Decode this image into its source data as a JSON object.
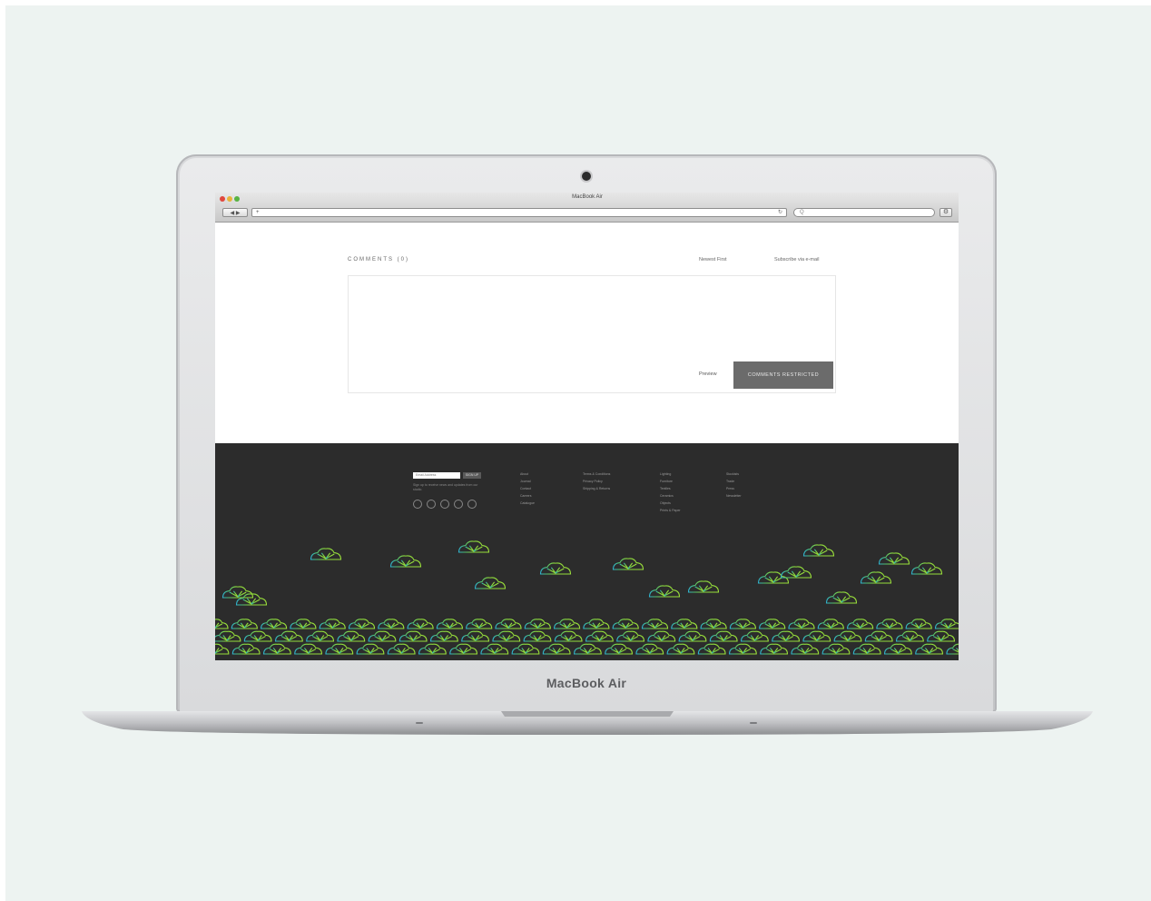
{
  "laptop": {
    "brand": "MacBook Air"
  },
  "browser": {
    "window_title": "MacBook Air",
    "nav_label": "◀ ▶",
    "url_prefix": "+",
    "reload_glyph": "↻",
    "search_prefix": "Q",
    "settings_glyph": "⚙"
  },
  "comments": {
    "title": "COMMENTS (0)",
    "sort_label": "Newest First",
    "subscribe_label": "Subscribe via e-mail",
    "preview_label": "Preview",
    "submit_label": "COMMENTS RESTRICTED"
  },
  "footer": {
    "newsletter_placeholder": "Email Address",
    "newsletter_button": "SIGN UP",
    "newsletter_note": "Sign up to receive news and updates from our studio.",
    "social_icons": [
      "twitter-icon",
      "facebook-icon",
      "instagram-icon",
      "pinterest-icon",
      "email-icon"
    ],
    "columns": [
      {
        "items": [
          "About",
          "Journal",
          "Contact",
          "Careers",
          "Catalogue"
        ]
      },
      {
        "items": [
          "Terms & Conditions",
          "Privacy Policy",
          "Shipping & Returns"
        ]
      },
      {
        "items": [
          "Lighting",
          "Furniture",
          "Textiles",
          "Ceramics",
          "Objects",
          "Prints & Paper"
        ]
      },
      {
        "items": [
          "Stockists",
          "Trade",
          "Press",
          "Newsletter"
        ]
      }
    ]
  },
  "colors": {
    "footer_bg": "#2c2c2c",
    "pattern_teal": "#2fb3cf",
    "pattern_green": "#8ddc3c",
    "submit_bg": "#6b6b6b"
  }
}
